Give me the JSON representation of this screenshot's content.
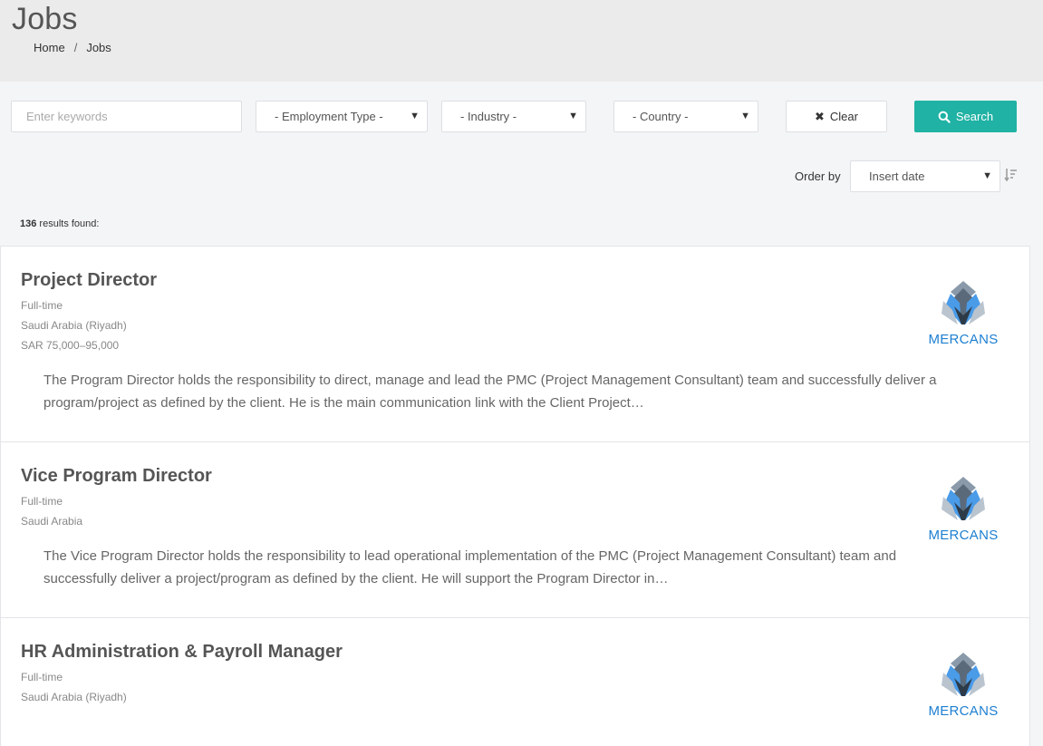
{
  "header": {
    "title": "Jobs",
    "breadcrumb": [
      "Home",
      "Jobs"
    ],
    "separator": "/"
  },
  "filters": {
    "keywords_placeholder": "Enter keywords",
    "employment_type": "- Employment Type -",
    "industry": "- Industry -",
    "country": "- Country -",
    "clear_label": "Clear",
    "search_label": "Search",
    "order_by_label": "Order by",
    "order_by_value": "Insert date"
  },
  "results": {
    "count": "136",
    "suffix": "results found:"
  },
  "jobs": [
    {
      "title": "Project Director",
      "type": "Full-time",
      "location": "Saudi Arabia (Riyadh)",
      "salary": "SAR 75,000–95,000",
      "description": "The Program Director holds the responsibility to direct, manage and lead the PMC (Project Management Consultant) team and successfully deliver a program/project as defined by the client. He is the main communication link with the Client Project…",
      "company": "MERCANS"
    },
    {
      "title": "Vice Program Director",
      "type": "Full-time",
      "location": "Saudi Arabia",
      "description": "The Vice Program Director holds the responsibility to lead operational implementation of the PMC (Project Management Consultant) team and successfully deliver a project/program as defined by the client. He will support the Program Director in…",
      "company": "MERCANS"
    },
    {
      "title": "HR Administration & Payroll Manager",
      "type": "Full-time",
      "location": "Saudi Arabia (Riyadh)",
      "company": "MERCANS"
    }
  ],
  "colors": {
    "accent": "#20b2a4",
    "logo_blue": "#1d7fd1"
  }
}
